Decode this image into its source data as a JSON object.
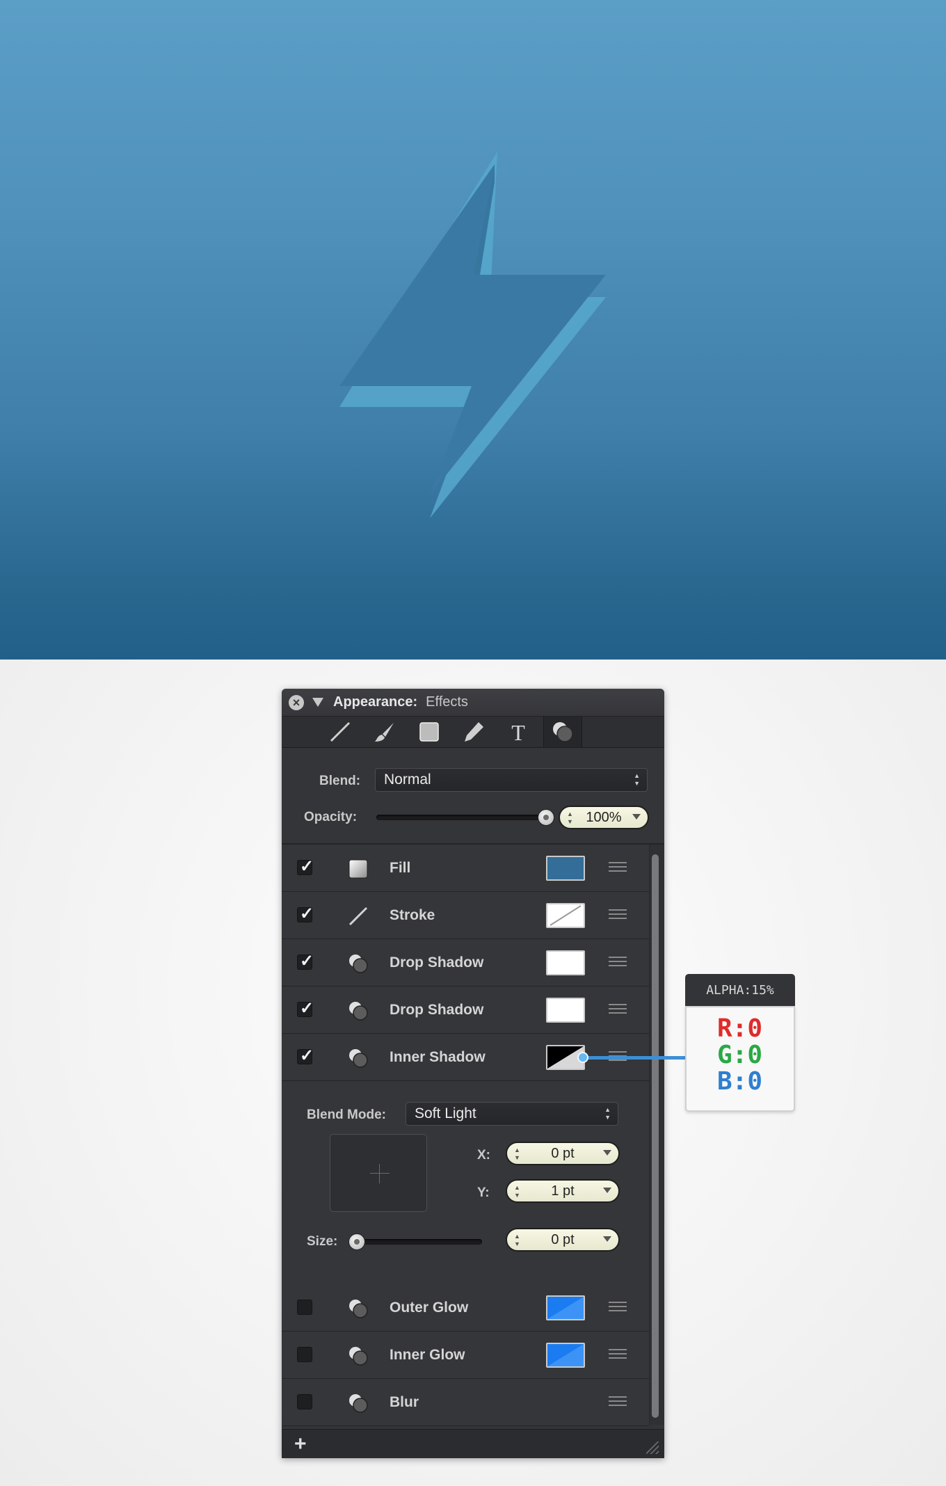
{
  "panel": {
    "title": "Appearance:",
    "subtitle": "Effects",
    "tools": [
      "stroke-line-icon",
      "brush-icon",
      "fill-square-icon",
      "pen-icon",
      "text-icon",
      "effects-icon"
    ],
    "blend_label": "Blend:",
    "blend_value": "Normal",
    "opacity_label": "Opacity:",
    "opacity_value": "100%",
    "opacity_level": 1.0,
    "effects": [
      {
        "name": "Fill",
        "enabled": true,
        "icon": "fill-square-icon",
        "swatch": "blue",
        "color": "#336d98"
      },
      {
        "name": "Stroke",
        "enabled": true,
        "icon": "stroke-line-icon",
        "swatch": "none",
        "color": "#ffffff"
      },
      {
        "name": "Drop Shadow",
        "enabled": true,
        "icon": "effects-icon",
        "swatch": "white",
        "color": "#ffffff"
      },
      {
        "name": "Drop Shadow",
        "enabled": true,
        "icon": "effects-icon",
        "swatch": "white",
        "color": "#ffffff"
      },
      {
        "name": "Inner Shadow",
        "enabled": true,
        "icon": "effects-icon",
        "swatch": "black-alpha",
        "color": "#000000"
      },
      {
        "name": "Outer Glow",
        "enabled": false,
        "icon": "effects-icon",
        "swatch": "glow",
        "color": "#1a7cf0"
      },
      {
        "name": "Inner Glow",
        "enabled": false,
        "icon": "effects-icon",
        "swatch": "glow",
        "color": "#1a7cf0"
      },
      {
        "name": "Blur",
        "enabled": false,
        "icon": "effects-icon",
        "swatch": "",
        "color": ""
      }
    ],
    "inner_shadow": {
      "blend_mode_label": "Blend Mode:",
      "blend_mode_value": "Soft Light",
      "x_label": "X:",
      "x_value": "0 pt",
      "y_label": "Y:",
      "y_value": "1 pt",
      "size_label": "Size:",
      "size_value": "0 pt",
      "size_level": 0.0
    },
    "add_label": "+"
  },
  "callout": {
    "alpha": "ALPHA:15%",
    "r": "R:0",
    "g": "G:0",
    "b": "B:0",
    "colors": {
      "r": "#e02b2b",
      "g": "#2aa845",
      "b": "#2f7fd0"
    }
  },
  "canvas": {
    "background_top": "#5b9ec6",
    "background_bottom": "#226089",
    "shape": "lightning-bolt",
    "shape_color": "#3979a4",
    "highlight_color": "#5aaed0"
  }
}
